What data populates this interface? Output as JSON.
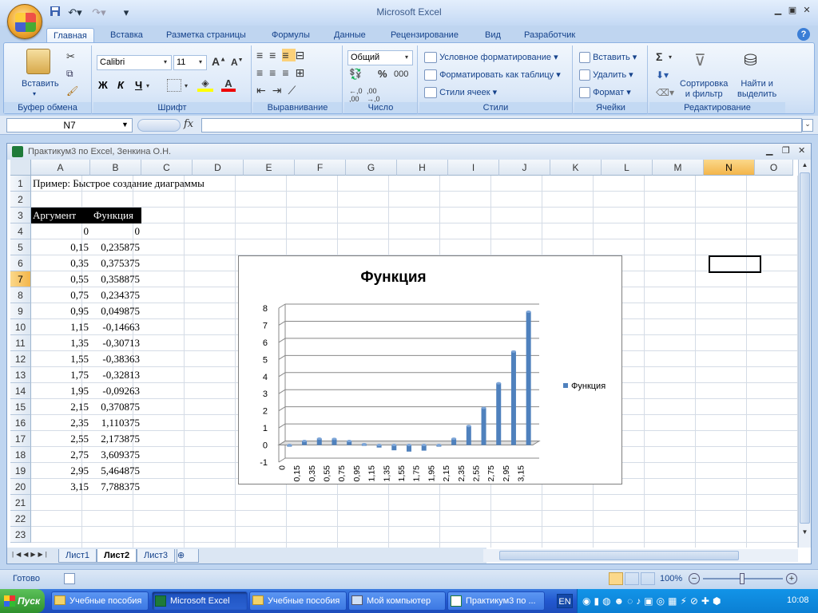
{
  "app": {
    "title": "Microsoft Excel"
  },
  "tabs": [
    "Главная",
    "Вставка",
    "Разметка страницы",
    "Формулы",
    "Данные",
    "Рецензирование",
    "Вид",
    "Разработчик"
  ],
  "ribbon": {
    "clipboard": {
      "paste": "Вставить",
      "label": "Буфер обмена"
    },
    "font": {
      "name": "Calibri",
      "size": "11",
      "bold": "Ж",
      "italic": "К",
      "underline": "Ч",
      "label": "Шрифт"
    },
    "alignment": {
      "label": "Выравнивание"
    },
    "number": {
      "format": "Общий",
      "percent": "%",
      "thousands": "000",
      "label": "Число"
    },
    "styles": {
      "conditional": "Условное форматирование",
      "as_table": "Форматировать как таблицу",
      "cell_styles": "Стили ячеек",
      "label": "Стили"
    },
    "cells": {
      "insert": "Вставить",
      "delete": "Удалить",
      "format": "Формат",
      "label": "Ячейки"
    },
    "editing": {
      "sigma": "Σ",
      "sort": "Сортировка\nи фильтр",
      "find": "Найти и\nвыделить",
      "label": "Редактирование"
    }
  },
  "formula_bar": {
    "name_box": "N7",
    "fx": "fx",
    "value": ""
  },
  "workbook": {
    "title": "Практикум3 по Excel, Зенкина О.Н."
  },
  "columns": [
    "A",
    "B",
    "C",
    "D",
    "E",
    "F",
    "G",
    "H",
    "I",
    "J",
    "K",
    "L",
    "M",
    "N",
    "O"
  ],
  "rows": [
    "1",
    "2",
    "3",
    "4",
    "5",
    "6",
    "7",
    "8",
    "9",
    "10",
    "11",
    "12",
    "13",
    "14",
    "15",
    "16",
    "17",
    "18",
    "19",
    "20",
    "21",
    "22",
    "23"
  ],
  "sheet": {
    "a1": "Пример: Быстрое создание диаграммы",
    "header_arg": "Аргумент",
    "header_fn": "Функция",
    "args": [
      "0",
      "0,15",
      "0,35",
      "0,55",
      "0,75",
      "0,95",
      "1,15",
      "1,35",
      "1,55",
      "1,75",
      "1,95",
      "2,15",
      "2,35",
      "2,55",
      "2,75",
      "2,95",
      "3,15"
    ],
    "fns": [
      "0",
      "0,235875",
      "0,375375",
      "0,358875",
      "0,234375",
      "0,049875",
      "-0,14663",
      "-0,30713",
      "-0,38363",
      "-0,32813",
      "-0,09263",
      "0,370875",
      "1,110375",
      "2,173875",
      "3,609375",
      "5,464875",
      "7,788375"
    ]
  },
  "chart_data": {
    "type": "bar",
    "title": "Функция",
    "categories": [
      "0",
      "0,15",
      "0,35",
      "0,55",
      "0,75",
      "0,95",
      "1,15",
      "1,35",
      "1,55",
      "1,75",
      "1,95",
      "2,15",
      "2,35",
      "2,55",
      "2,75",
      "2,95",
      "3,15"
    ],
    "series": [
      {
        "name": "Функция",
        "values": [
          0,
          0.235875,
          0.375375,
          0.358875,
          0.234375,
          0.049875,
          -0.14663,
          -0.30713,
          -0.38363,
          -0.32813,
          -0.09263,
          0.370875,
          1.110375,
          2.173875,
          3.609375,
          5.464875,
          7.788375
        ]
      }
    ],
    "ylim": [
      -1,
      8
    ],
    "yticks": [
      "-1",
      "0",
      "1",
      "2",
      "3",
      "4",
      "5",
      "6",
      "7",
      "8"
    ],
    "legend": "right",
    "color": "#4f81bd"
  },
  "sheet_tabs": [
    "Лист1",
    "Лист2",
    "Лист3"
  ],
  "status": {
    "ready": "Готово",
    "zoom": "100%"
  },
  "taskbar": {
    "start": "Пуск",
    "items": [
      "Учебные пособия",
      "Microsoft Excel",
      "Учебные пособия",
      "Мой компьютер",
      "Практикум3 по ..."
    ],
    "lang": "EN",
    "clock": "10:08"
  }
}
